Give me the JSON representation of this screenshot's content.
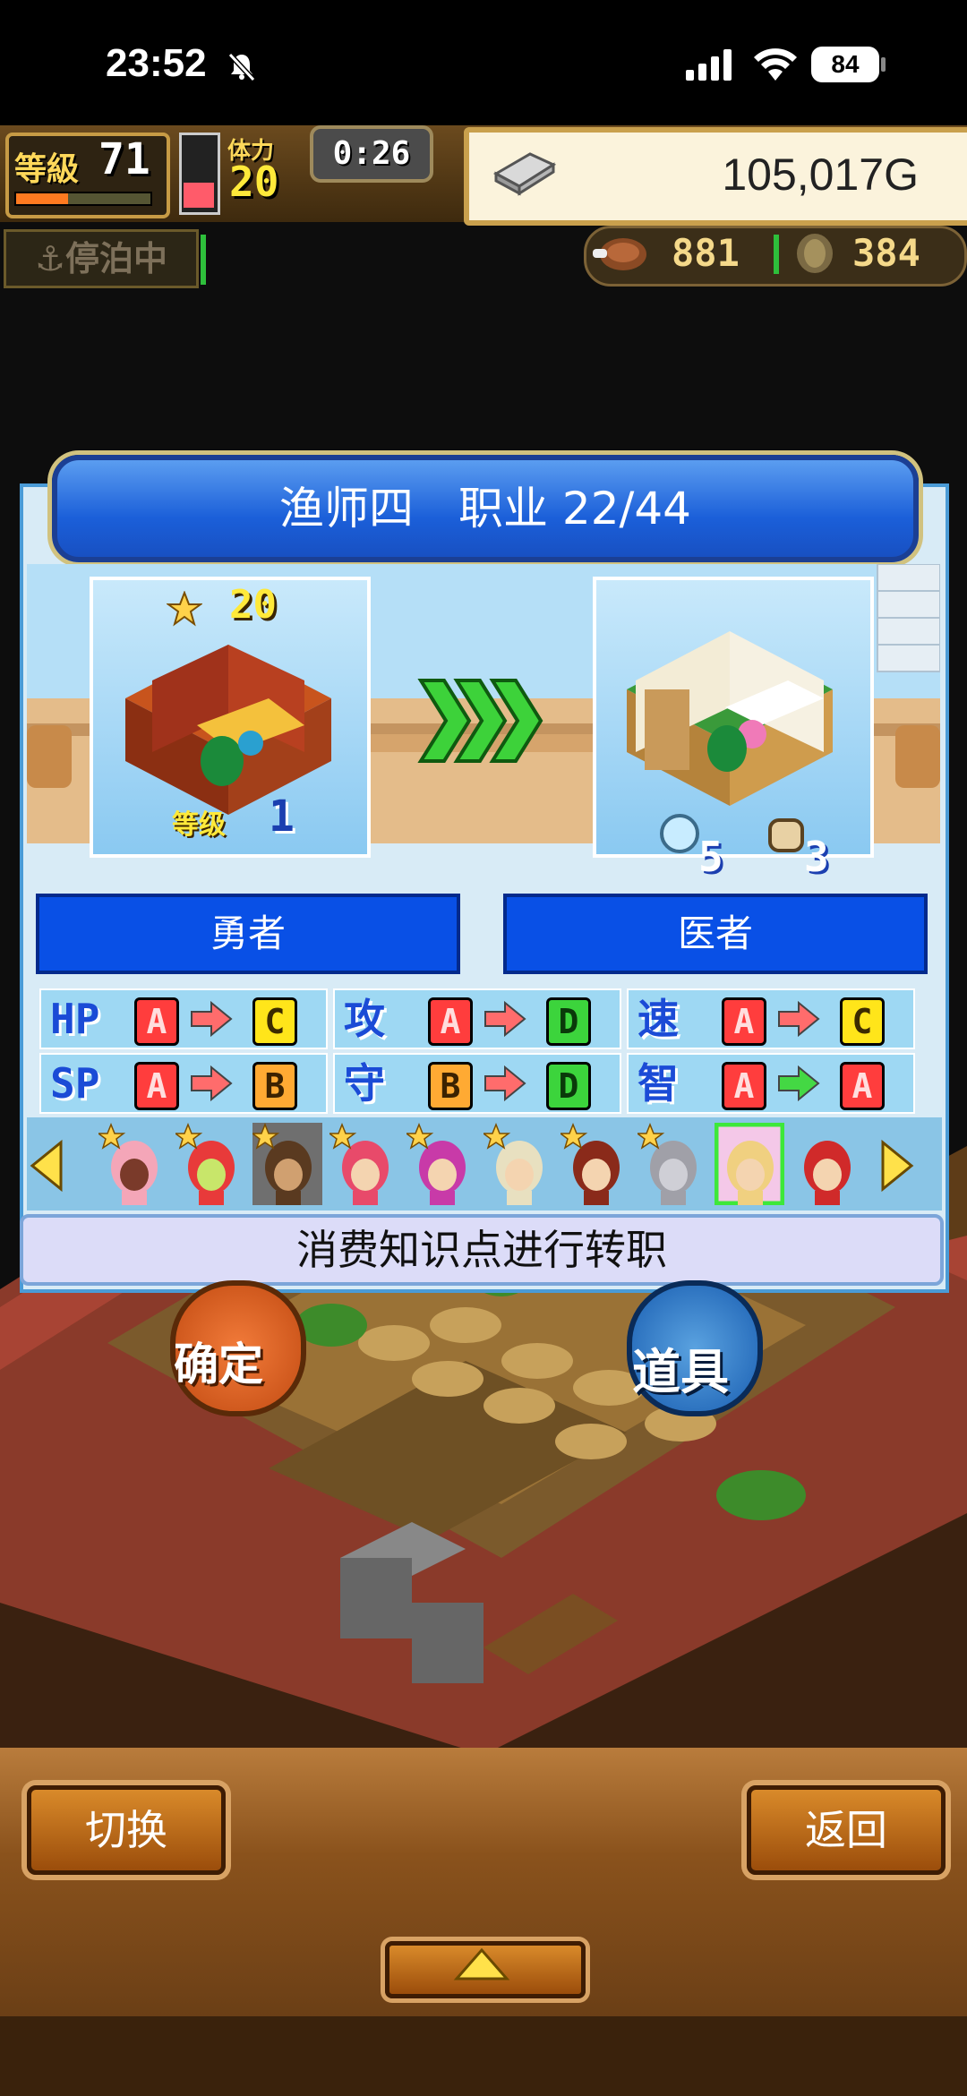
{
  "status_bar": {
    "time": "23:52",
    "battery": "84"
  },
  "hud": {
    "level_label": "等級",
    "level": "71",
    "level_progress": 0.4,
    "stamina_label": "体力",
    "stamina": "20",
    "stamina_fill": 0.35,
    "timer": "0:26",
    "money": "105,017G",
    "anchor_status": "停泊中",
    "food": "881",
    "ore": "384"
  },
  "dialog": {
    "title": "渔师四　职业 22/44",
    "from_card": {
      "stars": "20",
      "level_label": "等级",
      "level": "1"
    },
    "to_card": {
      "stat1": "5",
      "stat2": "3"
    },
    "from_class": "勇者",
    "to_class": "医者",
    "stats": [
      {
        "label": "HP",
        "from": "A",
        "to": "C",
        "arrow_color": "#ff6c6c"
      },
      {
        "label": "攻",
        "from": "A",
        "to": "D",
        "arrow_color": "#ff6c6c"
      },
      {
        "label": "速",
        "from": "A",
        "to": "C",
        "arrow_color": "#ff6c6c"
      },
      {
        "label": "SP",
        "from": "A",
        "to": "B",
        "arrow_color": "#ff6c6c"
      },
      {
        "label": "守",
        "from": "B",
        "to": "D",
        "arrow_color": "#ff6c6c"
      },
      {
        "label": "智",
        "from": "A",
        "to": "A",
        "arrow_color": "#44d844"
      }
    ],
    "hint": "消费知识点进行转职"
  },
  "actions": {
    "confirm": "确定",
    "items": "道具"
  },
  "bottom": {
    "switch": "切换",
    "back": "返回"
  },
  "colors": {
    "title_bar": "#1b5fd9",
    "class_button": "#0950e6",
    "wood": "#b97c3c"
  }
}
